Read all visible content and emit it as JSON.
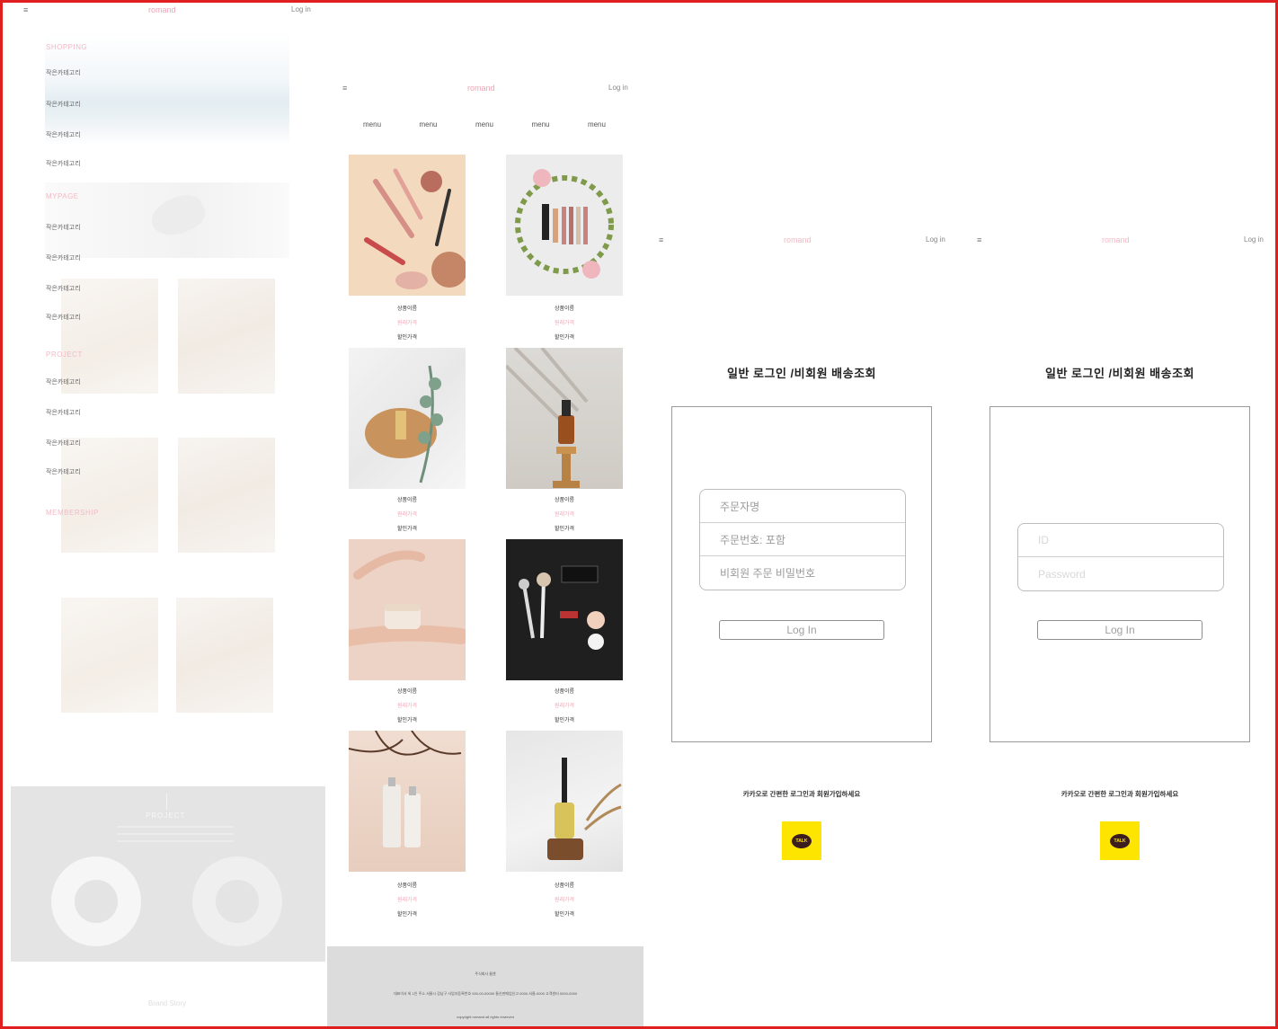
{
  "panel1": {
    "menu_icon": "≡",
    "logo": "romand",
    "login": "Log in",
    "sections": [
      {
        "title": "SHOPPING",
        "items": [
          "작은카테고리",
          "작은카테고리",
          "작은카테고리",
          "작은카테고리"
        ]
      },
      {
        "title": "MYPAGE",
        "items": [
          "작은카테고리",
          "작은카테고리",
          "작은카테고리",
          "작은카테고리"
        ]
      },
      {
        "title": "PROJECT",
        "items": [
          "작은카테고리",
          "작은카테고리",
          "작은카테고리",
          "작은카테고리"
        ]
      },
      {
        "title": "MEMBERSHIP",
        "items": []
      }
    ],
    "gray_title": "PROJECT",
    "bottom_text": "Brand Story"
  },
  "panel2": {
    "menu_icon": "≡",
    "logo": "romand",
    "login": "Log in",
    "nav": [
      "menu",
      "menu",
      "menu",
      "menu",
      "menu"
    ],
    "products": [
      {
        "name": "상품이름",
        "price": "원래가격",
        "sale": "할인가격"
      },
      {
        "name": "상품이름",
        "price": "원래가격",
        "sale": "할인가격"
      },
      {
        "name": "상품이름",
        "price": "원래가격",
        "sale": "할인가격"
      },
      {
        "name": "상품이름",
        "price": "원래가격",
        "sale": "할인가격"
      },
      {
        "name": "상품이름",
        "price": "원래가격",
        "sale": "할인가격"
      },
      {
        "name": "상품이름",
        "price": "원래가격",
        "sale": "할인가격"
      },
      {
        "name": "상품이름",
        "price": "원래가격",
        "sale": "할인가격"
      },
      {
        "name": "상품이름",
        "price": "원래가격",
        "sale": "할인가격"
      }
    ],
    "footer": {
      "line1": "주식회사 롬앤",
      "line2": "대표이사 외 1인 주소 서울시 강남구 사업자등록번호 000-00-00000 통신판매업신고 0000-서울-0000 고객센터 0000-0000",
      "line3": "copyright romand all rights reserved"
    }
  },
  "login_nonmember": {
    "menu_icon": "≡",
    "logo": "romand",
    "login": "Log in",
    "title": "일반 로그인 /비회원 배송조회",
    "fields": [
      "주문자명",
      "주문번호: 포함",
      "비회원 주문 비밀번호"
    ],
    "button": "Log In",
    "kakao_text": "카카오로 간편한 로그인과 회원가입하세요",
    "kakao_label": "TALK"
  },
  "login_member": {
    "menu_icon": "≡",
    "logo": "romand",
    "login": "Log in",
    "title": "일반 로그인 /비회원 배송조회",
    "fields": [
      "ID",
      "Password"
    ],
    "button": "Log In",
    "kakao_text": "카카오로 간편한 로그인과 회원가입하세요",
    "kakao_label": "TALK"
  },
  "colors": {
    "frame": "#e02020",
    "accent_pink": "#f0a4b6",
    "kakao_yellow": "#fee500"
  }
}
